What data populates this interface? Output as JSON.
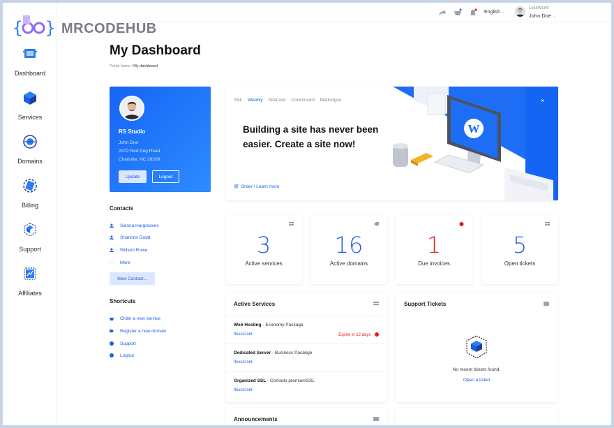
{
  "brand": {
    "name": "MRCODEHUB"
  },
  "nav": [
    {
      "label": "Dashboard",
      "icon": "dashboard-icon"
    },
    {
      "label": "Services",
      "icon": "services-box-icon"
    },
    {
      "label": "Domains",
      "icon": "domains-globe-icon"
    },
    {
      "label": "Billing",
      "icon": "billing-card-icon"
    },
    {
      "label": "Support",
      "icon": "support-box-icon"
    },
    {
      "label": "Affiliates",
      "icon": "affiliates-chart-icon"
    }
  ],
  "topbar": {
    "language": "English",
    "account_label": "LockWorth",
    "user_name": "John Doe"
  },
  "page": {
    "title": "My Dashboard",
    "breadcrumb_home": "Portal home",
    "breadcrumb_sep": "/",
    "breadcrumb_current": "My dashboard"
  },
  "profile": {
    "org": "RS Studio",
    "name": "John Doe",
    "address1": "2472 Red Dog Road",
    "address2": "Charlotte, NC 28209",
    "update_label": "Update",
    "logout_label": "Logout"
  },
  "contacts": {
    "title": "Contacts",
    "items": [
      "Sienna Hargreaves",
      "Shannon Dodd",
      "William Rowe"
    ],
    "more_label": "More",
    "new_label": "New Contact..."
  },
  "shortcuts": {
    "title": "Shortcuts",
    "items": [
      "Order a new service",
      "Register a new domain",
      "Support",
      "Logout"
    ]
  },
  "promo": {
    "tabs": [
      "SSL",
      "Weebly",
      "SiteLock",
      "CodeGuard",
      "Marketgoo"
    ],
    "active_tab": "Weebly",
    "headline": "Building a site has never been easier. Create a site now!",
    "link": "Order / Learn more",
    "close": "×"
  },
  "stats": [
    {
      "value": "3",
      "label": "Active services"
    },
    {
      "value": "16",
      "label": "Active domains"
    },
    {
      "value": "1",
      "label": "Due invoices"
    },
    {
      "value": "5",
      "label": "Open tickets"
    }
  ],
  "active_services": {
    "title": "Active Services",
    "rows": [
      {
        "name": "Web Hosting",
        "plan": " - Economy Package",
        "domain": "flexssl.net",
        "expiry": "Expire in 12 days"
      },
      {
        "name": "Dedicated Server",
        "plan": " - Business Pacakge",
        "domain": "flexssl.net"
      },
      {
        "name": "Organized SSL",
        "plan": " - Comodo premiumSSL",
        "domain": "flexssl.net"
      }
    ]
  },
  "support_tickets": {
    "title": "Support Tickets",
    "empty": "No recent tickets found.",
    "link": "Open a ticket"
  },
  "announcements": {
    "title": "Announcements"
  },
  "colors": {
    "accent": "#1d5de5",
    "danger": "#e21b1b",
    "profile_gradient_start": "#1565f5"
  }
}
